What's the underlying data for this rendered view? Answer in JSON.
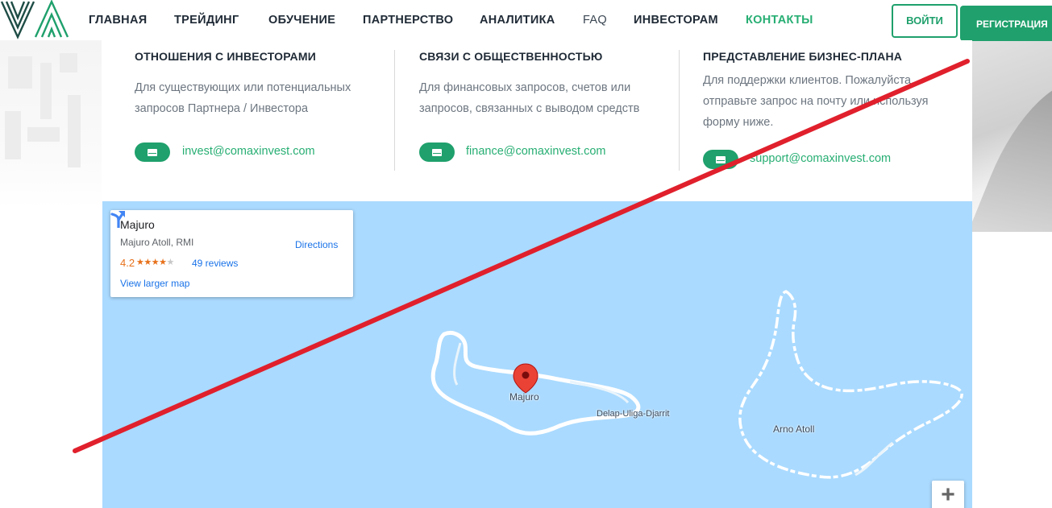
{
  "header": {
    "nav": [
      {
        "label": "ГЛАВНАЯ"
      },
      {
        "label": "ТРЕЙДИНГ"
      },
      {
        "label": "ОБУЧЕНИЕ"
      },
      {
        "label": "ПАРТНЕРСТВО"
      },
      {
        "label": "АНАЛИТИКА"
      },
      {
        "label": "FAQ"
      },
      {
        "label": "ИНВЕСТОРАМ"
      },
      {
        "label": "КОНТАКТЫ"
      }
    ],
    "active_item": "КОНТАКТЫ",
    "login_label": "ВОЙТИ",
    "register_label": "РЕГИСТРАЦИЯ"
  },
  "contacts": [
    {
      "title": "ОТНОШЕНИЯ С ИНВЕСТОРАМИ",
      "description": "Для существующих или потенциальных запросов Партнера / Инвестора",
      "email": "invest@comaxinvest.com",
      "icon": "envelope-icon"
    },
    {
      "title": "СВЯЗИ С ОБЩЕСТВЕННОСТЬЮ",
      "description": "Для финансовых запросов, счетов или запросов, связанных с выводом средств",
      "email": "finance@comaxinvest.com",
      "icon": "envelope-icon"
    },
    {
      "title": "ПРЕДСТАВЛЕНИЕ БИЗНЕС-ПЛАНА",
      "description": "Для поддержки клиентов. Пожалуйста, отправьте запрос на почту или используя форму ниже.",
      "email": "support@comaxinvest.com",
      "icon": "envelope-icon"
    }
  ],
  "map": {
    "place_name": "Majuro",
    "address": "Majuro Atoll, RMI",
    "rating": "4.2",
    "stars_filled": 4,
    "stars_total": 5,
    "reviews": "49 reviews",
    "directions_label": "Directions",
    "larger_map_label": "View larger map",
    "labels": {
      "majuro": "Majuro",
      "delap": "Delap-Uliga-Djarrit",
      "arno": "Arno Atoll"
    },
    "zoom_in_label": "+"
  },
  "colors": {
    "brand_green": "#1fa06c",
    "active_nav": "#27ae73",
    "water": "#aadaff",
    "strike_red": "#e0202c",
    "marker_red": "#ea4335"
  }
}
